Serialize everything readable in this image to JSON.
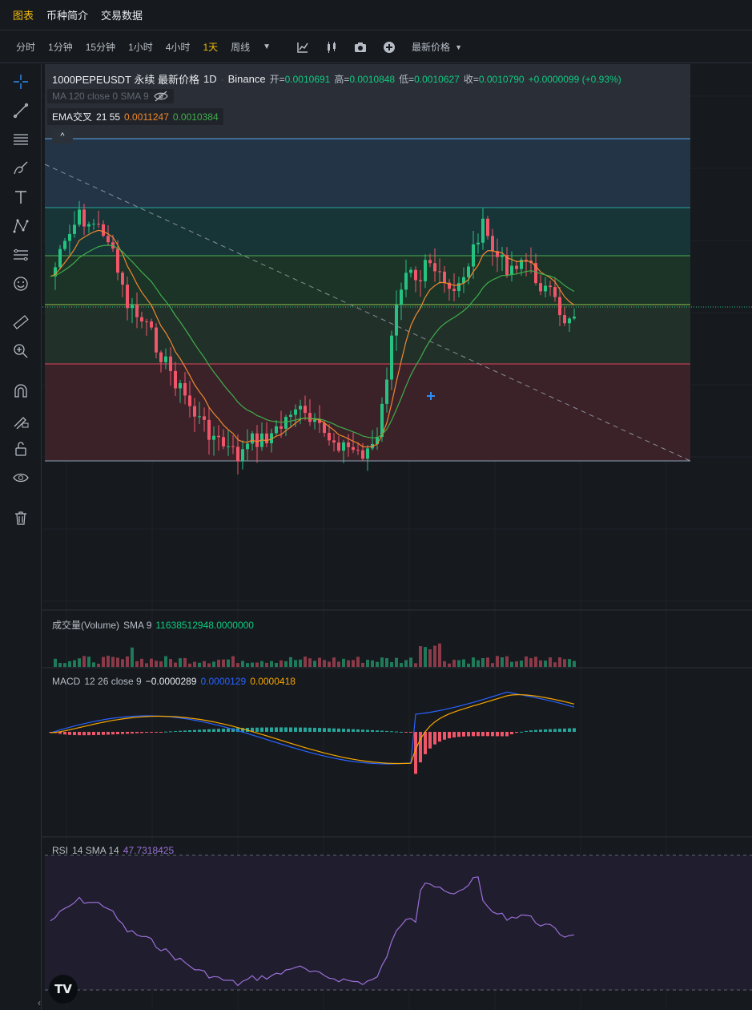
{
  "topnav": {
    "items": [
      "图表",
      "币种简介",
      "交易数据"
    ],
    "active": 0
  },
  "toolbar": {
    "intervals": [
      "分时",
      "1分钟",
      "15分钟",
      "1小时",
      "4小时",
      "1天",
      "周线"
    ],
    "active": 5,
    "icons": [
      "indicator-icon",
      "candle-style-icon",
      "camera-icon",
      "add-icon"
    ],
    "price_type": "最新价格"
  },
  "drawtools": [
    "crosshair-icon",
    "trendline-icon",
    "fib-lines-icon",
    "brush-icon",
    "text-icon",
    "pattern-icon",
    "measure-lines-icon",
    "emoji-icon",
    "ruler-icon",
    "zoom-in-icon",
    "magnet-icon",
    "lock-draw-icon",
    "unlock-icon",
    "eye-icon",
    "trash-icon"
  ],
  "main": {
    "symbol": "1000PEPEUSDT 永续 最新价格",
    "interval": "1D",
    "exchange": "Binance",
    "ohlc": {
      "open_label": "开=",
      "open": "0.0010691",
      "high_label": "高=",
      "high": "0.0010848",
      "low_label": "低=",
      "low": "0.0010627",
      "close_label": "收=",
      "close": "0.0010790",
      "change": "+0.0000099 (+0.93%)"
    },
    "ma_legend": "MA 120 close 0 SMA 9",
    "ema_legend": {
      "name": "EMA交叉",
      "params": "21 55",
      "v1": "0.0011247",
      "v2": "0.0010384"
    },
    "collapse": "^"
  },
  "volume": {
    "name": "成交量(Volume)",
    "sma": "SMA 9",
    "value": "11638512948.0000000"
  },
  "macd": {
    "name": "MACD",
    "params": "12 26 close 9",
    "hist": "−0.0000289",
    "macd": "0.0000129",
    "signal": "0.0000418"
  },
  "rsi": {
    "name": "RSI",
    "params": "14 SMA 14",
    "value": "47.7318425"
  },
  "logo": "TV",
  "colors": {
    "up": "#26c281",
    "down": "#f0566a",
    "accent": "#f0b90b",
    "ema_fast": "#f0882e",
    "ema_slow": "#3fae4a",
    "macd_line": "#2962ff",
    "signal_line": "#f7a600",
    "rsi_line": "#9b6fd6"
  }
}
